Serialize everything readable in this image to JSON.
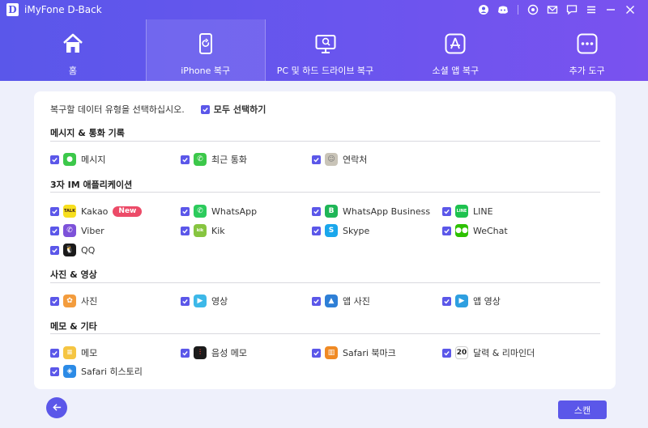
{
  "app": {
    "logo": "D",
    "title": "iMyFone D-Back"
  },
  "titlebar_icons": [
    "user-icon",
    "discord-icon",
    "target-icon",
    "mail-icon",
    "feedback-icon",
    "menu-icon",
    "minimize-icon",
    "close-icon"
  ],
  "nav": {
    "tabs": [
      {
        "label": "홈",
        "icon": "home-icon",
        "active": false
      },
      {
        "label": "iPhone 복구",
        "icon": "phone-restore-icon",
        "active": true
      },
      {
        "label": "PC 및 하드 드라이브 복구",
        "icon": "pc-restore-icon",
        "active": false
      },
      {
        "label": "소셜 앱 복구",
        "icon": "app-store-icon",
        "active": false
      },
      {
        "label": "추가 도구",
        "icon": "more-tools-icon",
        "active": false
      }
    ]
  },
  "main": {
    "prompt": "복구할 데이터 유형을 선택하십시오.",
    "select_all": "모두 선택하기",
    "sections": [
      {
        "title": "메시지 & 통화 기록",
        "items": [
          {
            "label": "메시지",
            "icon": "messages-icon",
            "color": "#3cc84a"
          },
          {
            "label": "최근 통화",
            "icon": "phone-icon",
            "color": "#3cc84a"
          },
          {
            "label": "연락처",
            "icon": "contacts-icon",
            "color": "#c9c4b8"
          }
        ]
      },
      {
        "title": "3자 IM 애플리케이션",
        "items": [
          {
            "label": "Kakao",
            "icon": "kakao-icon",
            "color": "#f7df1e",
            "badge": "New"
          },
          {
            "label": "WhatsApp",
            "icon": "whatsapp-icon",
            "color": "#2ccb5c"
          },
          {
            "label": "WhatsApp Business",
            "icon": "whatsapp-business-icon",
            "color": "#1fb657"
          },
          {
            "label": "LINE",
            "icon": "line-icon",
            "color": "#1ec24f"
          },
          {
            "label": "Viber",
            "icon": "viber-icon",
            "color": "#7d52d9"
          },
          {
            "label": "Kik",
            "icon": "kik-icon",
            "color": "#87c540"
          },
          {
            "label": "Skype",
            "icon": "skype-icon",
            "color": "#1aa7ec"
          },
          {
            "label": "WeChat",
            "icon": "wechat-icon",
            "color": "#2dc100"
          },
          {
            "label": "QQ",
            "icon": "qq-icon",
            "color": "#1a1a1a"
          }
        ]
      },
      {
        "title": "사진 & 영상",
        "items": [
          {
            "label": "사진",
            "icon": "photos-icon",
            "color": "#f39c3d"
          },
          {
            "label": "영상",
            "icon": "video-icon",
            "color": "#3db8e8"
          },
          {
            "label": "앱 사진",
            "icon": "app-photos-icon",
            "color": "#2e7fd6"
          },
          {
            "label": "앱 영상",
            "icon": "app-video-icon",
            "color": "#2e9fe0"
          }
        ]
      },
      {
        "title": "메모 & 기타",
        "items": [
          {
            "label": "메모",
            "icon": "notes-icon",
            "color": "#f5c542"
          },
          {
            "label": "음성 메모",
            "icon": "voice-memo-icon",
            "color": "#1b1b1b"
          },
          {
            "label": "Safari 북마크",
            "icon": "bookmark-icon",
            "color": "#f08a24"
          },
          {
            "label": "달력 & 리마인더",
            "icon": "calendar-icon",
            "color": "#ffffff",
            "day": "20"
          },
          {
            "label": "Safari 히스토리",
            "icon": "safari-icon",
            "color": "#2c8be6"
          }
        ]
      }
    ]
  },
  "buttons": {
    "back": "back-arrow-icon",
    "scan": "스캔"
  },
  "colors": {
    "accent": "#5b57e9",
    "header_start": "#5a57ea",
    "header_end": "#7a52ef"
  }
}
